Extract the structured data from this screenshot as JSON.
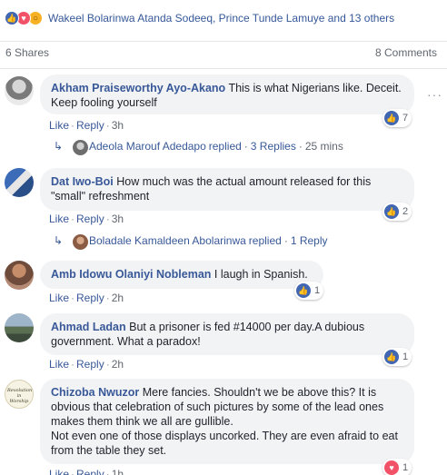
{
  "reactions": {
    "icons": [
      "like-icon",
      "love-icon",
      "wow-icon"
    ],
    "summary": "Wakeel Bolarinwa Atanda Sodeeq, Prince Tunde Lamuye and 13 others"
  },
  "stats": {
    "shares": "6 Shares",
    "comments": "8 Comments"
  },
  "actions": {
    "like": "Like",
    "reply": "Reply",
    "sep": "·"
  },
  "colors": {
    "link": "#385898",
    "like": "#4267b2",
    "love": "#f25268",
    "wow": "#f7b125",
    "bubble": "#f2f3f5"
  },
  "comments": [
    {
      "author": "Akham Praiseworthy Ayo-Akano",
      "text": "This is what Nigerians like. Deceit. Keep fooling yourself",
      "time": "3h",
      "reaction_icon": "like-icon",
      "reaction_count": "7",
      "reply": {
        "name": "Adeola Marouf Adedapo",
        "replied": "replied",
        "sep": "·",
        "count": "3 Replies",
        "time": "25 mins"
      }
    },
    {
      "author": "Dat Iwo-Boi",
      "text": "How much was the actual amount released for this \"small\" refreshment",
      "time": "3h",
      "reaction_icon": "like-icon",
      "reaction_count": "2",
      "reply": {
        "name": "Boladale Kamaldeen Abolarinwa",
        "replied": "replied",
        "sep": "·",
        "count": "1 Reply"
      }
    },
    {
      "author": "Amb Idowu Olaniyi Nobleman",
      "text": "I laugh in Spanish.",
      "time": "2h",
      "reaction_icon": "like-icon",
      "reaction_count": "1"
    },
    {
      "author": "Ahmad Ladan",
      "text": "But a prisoner is fed #14000 per day.A dubious government. What a paradox!",
      "time": "2h",
      "reaction_icon": "like-icon",
      "reaction_count": "1"
    },
    {
      "author": "Chizoba Nwuzor",
      "text": "Mere fancies. Shouldn't we be above this? It is obvious that celebration of such pictures by some of the lead ones makes them think we all are gullible.",
      "text2": "Not even one of those displays uncorked. They are even afraid to eat from the table they set.",
      "avatar_text": "Revolution in Worship",
      "time": "1h",
      "reaction_icon": "love-icon",
      "reaction_count": "1"
    }
  ]
}
